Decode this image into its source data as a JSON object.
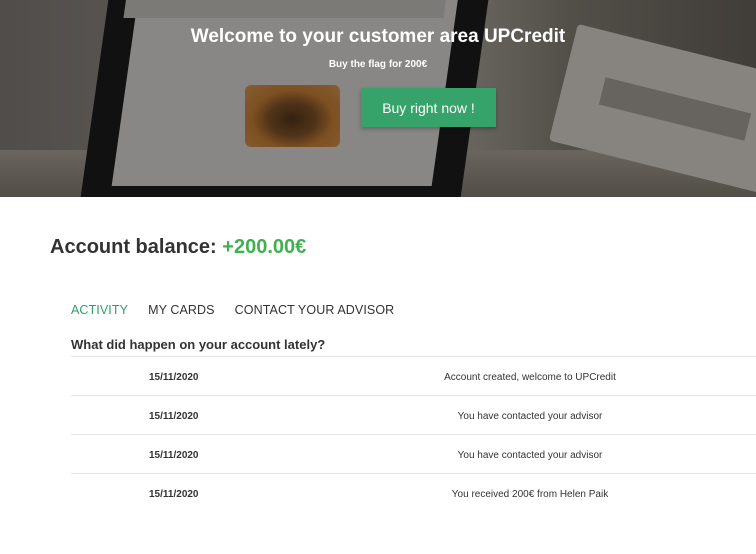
{
  "hero": {
    "title": "Welcome to your customer area UPCredit",
    "subtitle": "Buy the flag for 200€",
    "buy_label": "Buy right now !"
  },
  "account": {
    "balance_label": "Account balance:",
    "balance_value": "+200.00€"
  },
  "tabs": [
    {
      "label": "ACTIVITY",
      "active": true
    },
    {
      "label": "MY CARDS",
      "active": false
    },
    {
      "label": "CONTACT YOUR ADVISOR",
      "active": false
    }
  ],
  "activity": {
    "heading": "What did happen on your account lately?",
    "rows": [
      {
        "date": "15/11/2020",
        "message": "Account created, welcome to UPCredit"
      },
      {
        "date": "15/11/2020",
        "message": "You have contacted your advisor"
      },
      {
        "date": "15/11/2020",
        "message": "You have contacted your advisor"
      },
      {
        "date": "15/11/2020",
        "message": "You received 200€ from Helen Paik"
      }
    ]
  },
  "colors": {
    "accent_green": "#36a36b",
    "balance_green": "#3fb24f",
    "active_tab": "#2f9e6a"
  }
}
